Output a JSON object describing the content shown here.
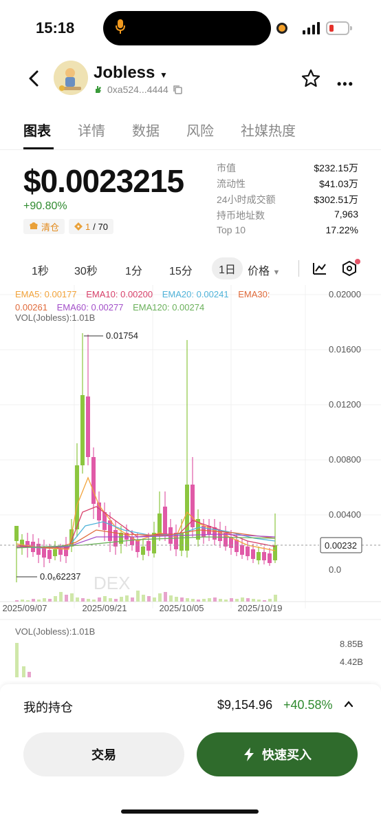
{
  "status": {
    "time": "15:18"
  },
  "header": {
    "coin": "Jobless",
    "address": "0xa524...4444"
  },
  "tabs": [
    "图表",
    "详情",
    "数据",
    "风险",
    "社媒热度"
  ],
  "price": {
    "value": "$0.0023215",
    "change": "+90.80%",
    "badge1": "清仓",
    "badge2_a": "1",
    "badge2_b": "/ 70"
  },
  "stats": [
    {
      "k": "市值",
      "v": "$232.15万"
    },
    {
      "k": "流动性",
      "v": "$41.03万"
    },
    {
      "k": "24小时成交额",
      "v": "$302.51万"
    },
    {
      "k": "持币地址数",
      "v": "7,963"
    },
    {
      "k": "Top 10",
      "v": "17.22%"
    }
  ],
  "intervals": [
    "1秒",
    "30秒",
    "1分",
    "15分",
    "1日",
    "价格"
  ],
  "chart": {
    "ema5": "EMA5: 0.00177",
    "ema10": "EMA10: 0.00200",
    "ema20": "EMA20: 0.00241",
    "ema30": "EMA30:",
    "ema30_val": "0.00261",
    "ema60": "EMA60: 0.00277",
    "ema120": "EMA120: 0.00274",
    "vol": "VOL(Jobless):1.01B",
    "vol2": "VOL(Jobless):1.01B",
    "y_ticks": [
      "0.02000",
      "0.01600",
      "0.01200",
      "0.00800",
      "0.00400",
      "0.0"
    ],
    "x_ticks": [
      "2025/09/07",
      "2025/09/21",
      "2025/10/05",
      "2025/10/19"
    ],
    "current": "0.00232",
    "high_label": "0.01754",
    "low_label": "0.0₆62237",
    "vol_ticks": [
      "8.85B",
      "4.42B"
    ],
    "watermark": "DEX",
    "colors": {
      "up": "#8cc63f",
      "down": "#e05aa7"
    }
  },
  "holdings": {
    "label": "我的持仓",
    "value": "$9,154.96",
    "change": "+40.58%"
  },
  "buttons": {
    "trade": "交易",
    "buy": "快速买入"
  }
}
